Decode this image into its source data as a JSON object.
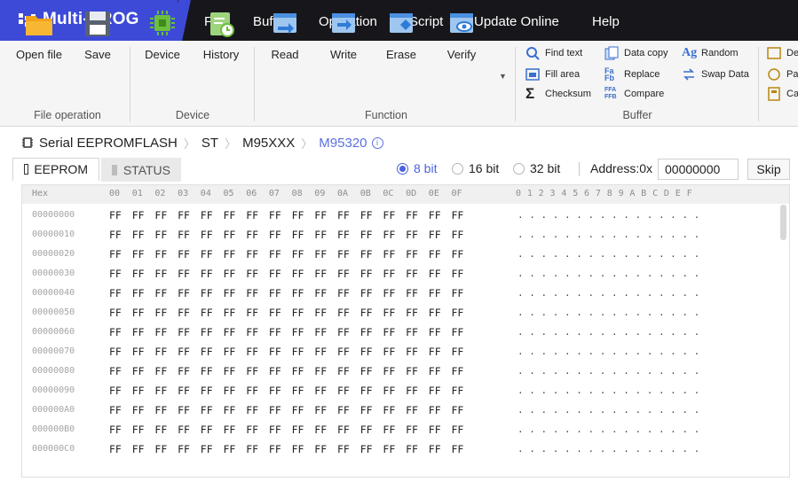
{
  "app": {
    "title": "Multi-PROG"
  },
  "menu": [
    "File",
    "Buffer",
    "Operation",
    "Script",
    "Update Online",
    "Help"
  ],
  "ribbon": {
    "file_operation": {
      "label": "File operation",
      "buttons": [
        "Open file",
        "Save"
      ]
    },
    "device": {
      "label": "Device",
      "buttons": [
        "Device",
        "History"
      ]
    },
    "function": {
      "label": "Function",
      "buttons": [
        "Read",
        "Write",
        "Erase",
        "Verify"
      ]
    },
    "buffer": {
      "label": "Buffer",
      "col1": [
        "Find text",
        "Fill area",
        "Checksum"
      ],
      "col2": [
        "Data copy",
        "Replace",
        "Compare"
      ],
      "col3": [
        "Random",
        "Swap Data"
      ]
    },
    "overflow": [
      "De",
      "Pa",
      "Ca"
    ]
  },
  "breadcrumb": {
    "parts": [
      "Serial EEPROMFLASH",
      "ST",
      "M95XXX",
      "M95320"
    ]
  },
  "tabs": [
    "EEPROM",
    "STATUS"
  ],
  "bit_options": [
    "8 bit",
    "16 bit",
    "32 bit"
  ],
  "selected_bit": "8 bit",
  "address": {
    "label": "Address:0x",
    "value": "00000000"
  },
  "skip_label": "Skip",
  "grid": {
    "addr_header": "Hex",
    "byte_headers": [
      "00",
      "01",
      "02",
      "03",
      "04",
      "05",
      "06",
      "07",
      "08",
      "09",
      "0A",
      "0B",
      "0C",
      "0D",
      "0E",
      "0F"
    ],
    "ascii_header": "0 1 2 3 4 5 6 7 8 9 A B C D E F",
    "byte_value": "FF",
    "ascii_value": ". . . . . . . . . . . . . . . .",
    "rows": [
      "00000000",
      "00000010",
      "00000020",
      "00000030",
      "00000040",
      "00000050",
      "00000060",
      "00000070",
      "00000080",
      "00000090",
      "000000A0",
      "000000B0",
      "000000C0"
    ]
  },
  "colors": {
    "titlebar": "#17171b",
    "brand": "#3d4ad8",
    "accent": "#4a62e0",
    "ribbon_bg": "#f5f5f5"
  }
}
